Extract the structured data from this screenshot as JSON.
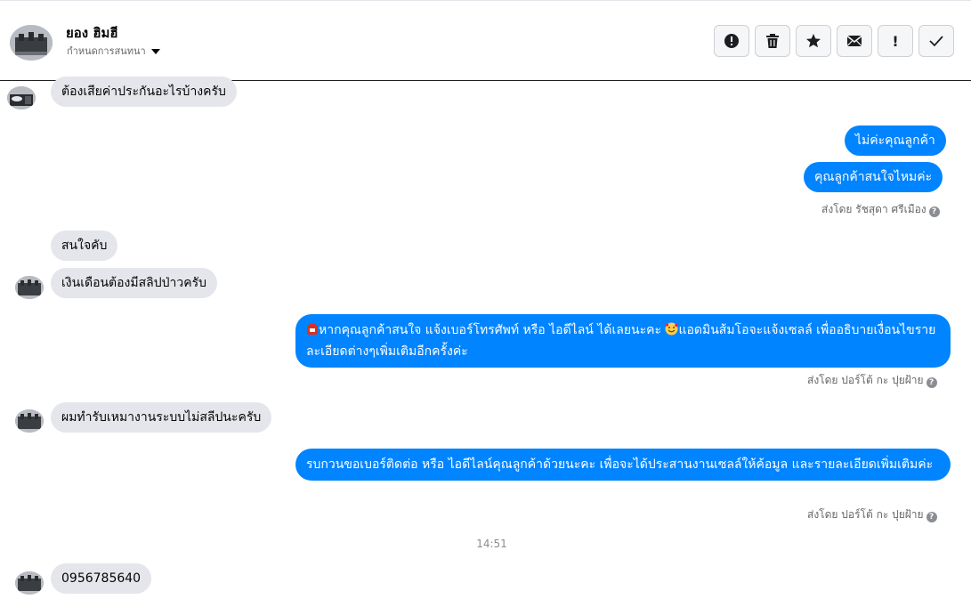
{
  "header": {
    "name": "ยอง ฮิมฮี",
    "subtitle": "กำหนดการสนทนา",
    "actions": [
      {
        "name": "report-button",
        "icon": "alert-circle-icon"
      },
      {
        "name": "delete-button",
        "icon": "trash-icon"
      },
      {
        "name": "star-button",
        "icon": "star-icon"
      },
      {
        "name": "mail-button",
        "icon": "envelope-icon"
      },
      {
        "name": "mark-important-button",
        "icon": "exclamation-icon",
        "label": "!"
      },
      {
        "name": "mark-done-button",
        "icon": "check-icon"
      }
    ]
  },
  "messages": {
    "m1": "ต้องเสียค่าประกันอะไรบ้างครับ",
    "m2": "ไม่ค่ะคุณลูกค้า",
    "m3": "คุณลูกค้าสนใจไหมค่ะ",
    "sent1": "ส่งโดย รัชสุดา ศรีเมือง",
    "m4": "สนใจคับ",
    "m5": "เงินเดือนต้องมีสลิปป่าวครับ",
    "m6_text": "หากคุณลูกค้าสนใจ แจ้งเบอร์โทรศัพท์ หรือ ไอดีไลน์  ได้เลยนะคะ ",
    "m6_text2": "แอดมินส้มโอจะแจ้งเซลล์   เพื่ออธิบายเงื่อนไขรายละเอียดต่างๆเพิ่มเติมอีกครั้งค่ะ",
    "sent2": "ส่งโดย ปอร์โต้ กะ ปุยฝ้าย",
    "m7": "ผมทำรับเหมางานระบบไม่สลีปนะครับ",
    "m8": "รบกวนขอเบอร์ติดต่อ หรือ ไอดีไลน์คุณลูกค้าด้วยนะคะ เพื่อจะได้ประสานงานเซลล์ให้ค้อมูล และรายละเอียดเพิ่มเติมค่ะ",
    "sent3": "ส่งโดย ปอร์โต้ กะ ปุยฝ้าย",
    "time": "14:51",
    "m9": "0956785640"
  },
  "help_mark": "?",
  "colors": {
    "outgoing": "#0084ff",
    "incoming": "#e4e6eb"
  }
}
